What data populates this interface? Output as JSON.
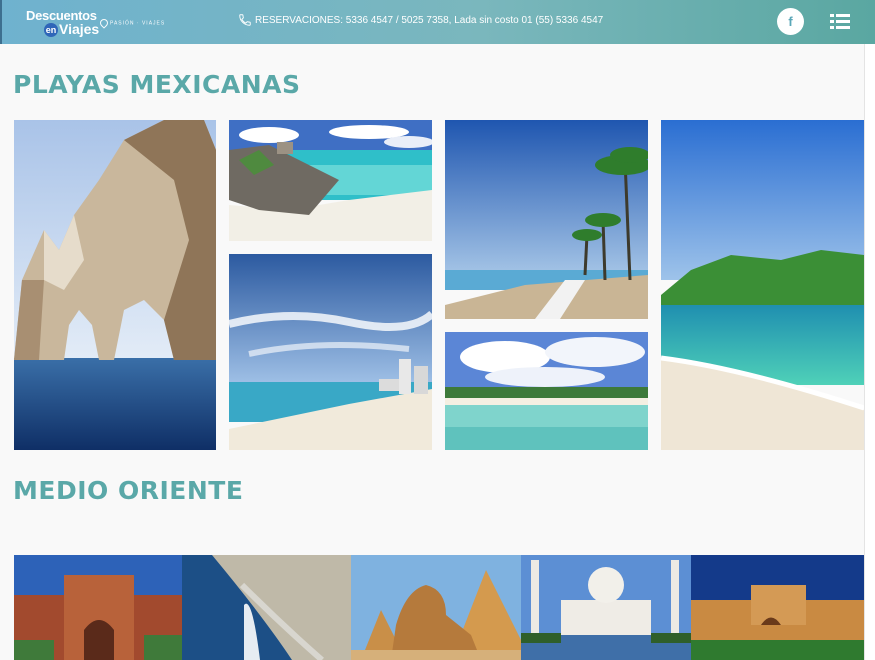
{
  "header": {
    "logo_line1": "Descuentos",
    "logo_en": "en",
    "logo_line2": "Viajes",
    "logo_tagline": "PASIÓN · VIAJES",
    "reservations": "RESERVACIONES: 5336 4547 / 5025 7358, Lada sin costo 01 (55) 5336 4547",
    "facebook_label": "f",
    "icons": [
      "phone-icon",
      "facebook-icon",
      "menu-icon",
      "location-pin-icon"
    ]
  },
  "sections": [
    {
      "title": "PLAYAS MEXICANAS",
      "photos": [
        "los-cabos-arch-photo",
        "tulum-beach-photo",
        "cancun-hotel-zone-photo",
        "puerto-vallarta-boardwalk-photo",
        "riviera-maya-photo",
        "huatulco-bay-photo"
      ]
    },
    {
      "title": "MEDIO ORIENTE",
      "photos": [
        "morocco-palace-photo",
        "dubai-palm-photo",
        "egypt-sphinx-photo",
        "taj-mahal-photo",
        "morocco-garden-photo"
      ]
    }
  ],
  "colors": {
    "header_start": "#6fb2cf",
    "header_end": "#5aa7a1",
    "title": "#5aa8a8",
    "background": "#f9f9f9"
  }
}
